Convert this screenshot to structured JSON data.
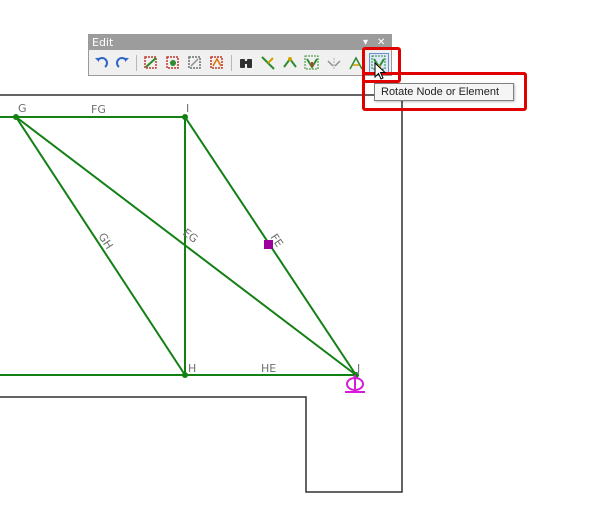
{
  "toolbar": {
    "title": "Edit",
    "dropdown_glyph": "▾",
    "close_glyph": "✕",
    "buttons": [
      {
        "name": "undo-icon",
        "color": "#2b63c6"
      },
      {
        "name": "redo-icon",
        "color": "#2b63c6"
      },
      {
        "name": "select-element-icon",
        "color": "#c0392b"
      },
      {
        "name": "select-node-icon",
        "color": "#2e8b2e"
      },
      {
        "name": "select-window-icon",
        "color": "#707070"
      },
      {
        "name": "select-polygon-icon",
        "color": "#c0392b"
      },
      {
        "name": "find-icon",
        "color": "#303030"
      },
      {
        "name": "trim-icon",
        "color": "#2e8b2e"
      },
      {
        "name": "move-node-icon",
        "color": "#2e8b2e"
      },
      {
        "name": "copy-element-icon",
        "color": "#2e8b2e"
      },
      {
        "name": "mirror-icon",
        "color": "#909090"
      },
      {
        "name": "divide-element-icon",
        "color": "#2e8b2e"
      },
      {
        "name": "rotate-node-icon",
        "color": "#2e8b2e"
      }
    ]
  },
  "tooltip": {
    "text": "Rotate Node or Element"
  },
  "model": {
    "line_color": "#138013",
    "node_labels": {
      "G": "G",
      "I": "I",
      "H": "H",
      "J": "J"
    },
    "element_labels": {
      "FG": "FG",
      "GH": "GH",
      "EG": "EG",
      "FE": "FE",
      "HE": "HE"
    },
    "support_color": "#d81bd8",
    "selected_marker_color": "#9b009b"
  }
}
